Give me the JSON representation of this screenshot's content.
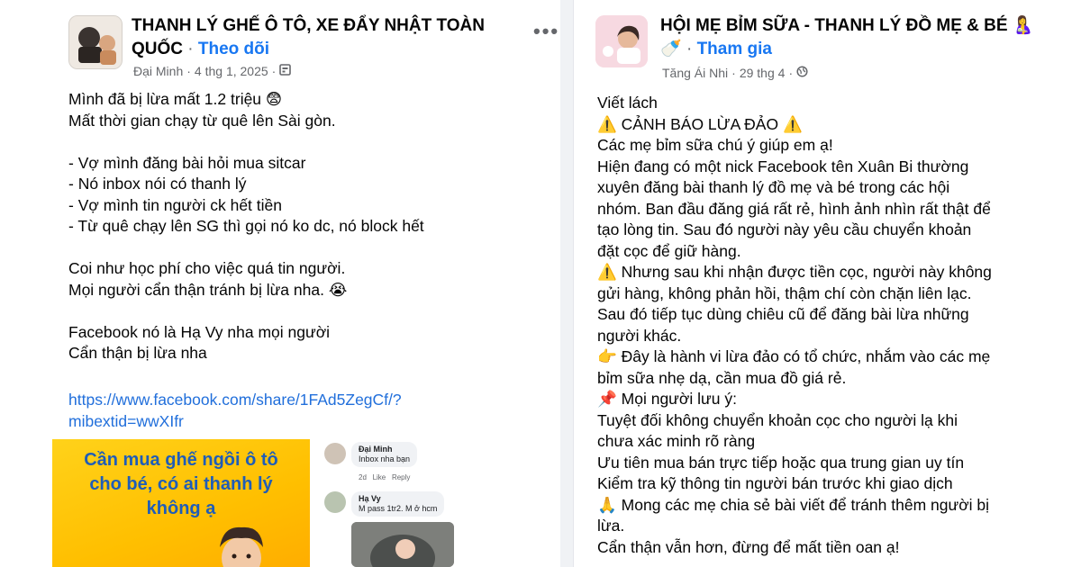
{
  "left_post": {
    "group_name_line1": "THANH LÝ GHẾ Ô TÔ, XE ĐẨY NHẬT TOÀN",
    "group_name_line2": "QUỐC",
    "separator": " · ",
    "follow_label": "Theo dõi",
    "author": "Đại Minh",
    "date": "4 thg 1, 2025",
    "more_label": "•••",
    "lines": [
      "Mình đã bị lừa mất 1.2 triệu 😨",
      "Mất thời gian chạy từ quê lên Sài gòn.",
      "",
      "- Vợ mình đăng bài hỏi mua sitcar",
      "- Nó inbox nói có thanh lý",
      "- Vợ mình tin người ck hết tiền",
      "- Từ quê chạy lên SG thì gọi nó ko dc, nó block hết",
      "",
      "Coi như học phí cho việc quá tin người.",
      "Mọi người cẩn thận tránh bị lừa nha. 😭",
      "",
      "Facebook nó là Hạ Vy nha mọi người",
      "Cẩn thận bị lừa nha",
      ""
    ],
    "link_line1": "https://www.facebook.com/share/1FAd5ZegCf/?",
    "link_line2": "mibextid=wwXIfr",
    "promo_text": [
      "Cần mua ghế ngồi ô tô",
      "cho bé, có ai thanh lý",
      "không ạ"
    ],
    "comments": [
      {
        "name": "Đại Minh",
        "text": "Inbox nha bạn",
        "time": "2d",
        "like": "Like",
        "reply": "Reply"
      },
      {
        "name": "Hạ Vy",
        "text": "M pass 1tr2. M ở hcm"
      }
    ]
  },
  "right_post": {
    "group_name_line1": "HỘI MẸ BỈM SỮA - THANH LÝ ĐỒ MẸ & BÉ 🤱",
    "group_name_line2_emoji": "🍼",
    "separator": " · ",
    "join_label": "Tham gia",
    "author": "Tăng Ái Nhi",
    "date": "29 thg 4",
    "lines": [
      "Viết lách",
      "⚠️ CẢNH BÁO LỪA ĐẢO ⚠️",
      "Các mẹ bỉm sữa chú ý giúp em ạ!",
      "Hiện đang có một nick Facebook tên Xuân Bi thường",
      "xuyên đăng bài thanh lý đồ mẹ và bé trong các hội",
      "nhóm. Ban đầu đăng giá rất rẻ, hình ảnh nhìn rất thật để",
      "tạo lòng tin. Sau đó người này yêu cầu chuyển khoản",
      "đặt cọc để giữ hàng.",
      "⚠️ Nhưng sau khi nhận được tiền cọc, người này không",
      "gửi hàng, không phản hồi, thậm chí còn chặn liên lạc.",
      "Sau đó tiếp tục dùng chiêu cũ để đăng bài lừa những",
      "người khác.",
      "👉 Đây là hành vi lừa đảo có tổ chức, nhắm vào các mẹ",
      "bỉm sữa nhẹ dạ, cần mua đồ giá rẻ.",
      "📌 Mọi người lưu ý:",
      "Tuyệt đối không chuyển khoản cọc cho người lạ khi",
      "chưa xác minh rõ ràng",
      "Ưu tiên mua bán trực tiếp hoặc qua trung gian uy tín",
      "Kiểm tra kỹ thông tin người bán trước khi giao dịch",
      "🙏 Mong các mẹ chia sẻ bài viết để tránh thêm người bị",
      "lừa.",
      "Cẩn thận vẫn hơn, đừng để mất tiền oan ạ!"
    ]
  },
  "colors": {
    "link": "#216fdb",
    "follow": "#1877f2",
    "meta": "#65676b",
    "promo_bg": "#ffc400",
    "promo_text": "#1f5db8"
  },
  "icons": {
    "privacy_left": "globe-calendar-icon",
    "privacy_right": "globe-icon"
  }
}
